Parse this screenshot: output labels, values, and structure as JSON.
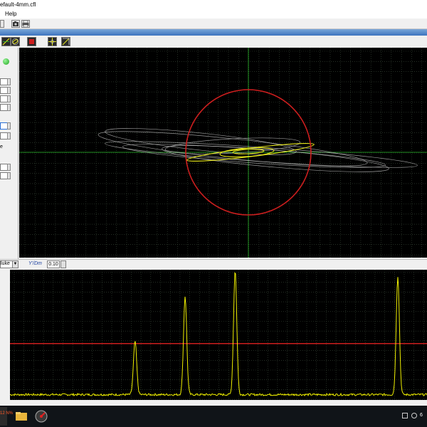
{
  "window": {
    "title": "efault-4mm.cfl"
  },
  "menu": {
    "items": [
      "Help"
    ]
  },
  "controls": {
    "trace_select_value": "luke",
    "ratio_label": "Y'/Dm",
    "ratio_value": "0.10",
    "side_label": "e"
  },
  "taskbar": {
    "start_text": "12 N%",
    "clock": "6"
  },
  "plots": {
    "xy": {
      "type": "impedance-plane",
      "background": "#000000",
      "grid_color": "#3a4a3a",
      "axis_color": "#29b829",
      "circle_color": "#cc1e1e",
      "trace_color": "#c8c8c8",
      "signal_color": "#e6e61a"
    },
    "time": {
      "type": "line",
      "background": "#000000",
      "threshold_color": "#cc1e1e",
      "signal_color": "#f0f000",
      "peaks": [
        {
          "position": 0.3,
          "height": 0.43
        },
        {
          "position": 0.42,
          "height": 0.79
        },
        {
          "position": 0.54,
          "height": 1.0
        },
        {
          "position": 0.93,
          "height": 0.95
        }
      ],
      "threshold_level": 0.43
    }
  },
  "icons": {
    "toolbar1": [
      "config-icon",
      "camera-icon",
      "printer-icon"
    ],
    "toolbar2": [
      "xy-view-icon",
      "lissajous-icon",
      "stop-icon",
      "grid-icon",
      "zoom-icon"
    ],
    "taskbar": [
      "file-explorer-icon",
      "app-icon"
    ]
  }
}
